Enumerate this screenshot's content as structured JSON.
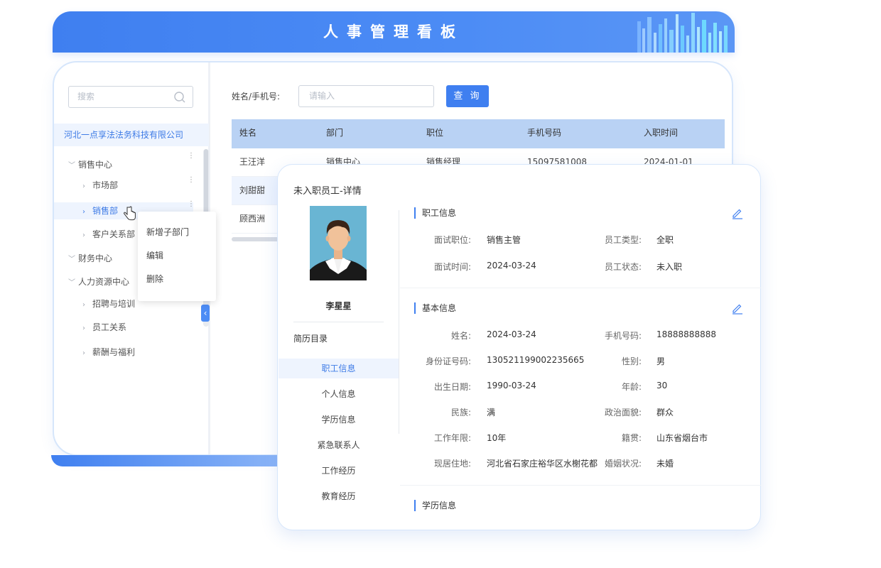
{
  "header": {
    "title": "人事管理看板"
  },
  "sidebar": {
    "search_placeholder": "搜索",
    "company": "河北一点享法法务科技有限公司",
    "tree": {
      "sales_center": "销售中心",
      "market": "市场部",
      "sales": "销售部",
      "customer": "客户关系部",
      "finance": "财务中心",
      "hr_center": "人力资源中心",
      "recruit": "招聘与培训",
      "relations": "员工关系",
      "salary": "薪酬与福利"
    },
    "context_menu": {
      "add_sub": "新增子部门",
      "edit": "编辑",
      "delete": "删除"
    }
  },
  "query": {
    "label": "姓名/手机号:",
    "placeholder": "请输入",
    "button": "查 询"
  },
  "table": {
    "columns": [
      "姓名",
      "部门",
      "职位",
      "手机号码",
      "入职时间"
    ],
    "rows": [
      [
        "王汪洋",
        "销售中心",
        "销售经理",
        "15097581008",
        "2024-01-01"
      ],
      [
        "刘甜甜",
        "",
        "",
        "",
        ""
      ],
      [
        "顾西洲",
        "",
        "",
        "",
        ""
      ]
    ]
  },
  "detail": {
    "title": "未入职员工-详情",
    "name": "李星星",
    "resume_title": "简历目录",
    "nav": [
      "职工信息",
      "个人信息",
      "学历信息",
      "紧急联系人",
      "工作经历",
      "教育经历"
    ],
    "job_section": {
      "title": "职工信息",
      "fields": {
        "position_label": "面试职位:",
        "position": "销售主管",
        "type_label": "员工类型:",
        "type": "全职",
        "time_label": "面试时间:",
        "time": "2024-03-24",
        "status_label": "员工状态:",
        "status": "未入职"
      }
    },
    "basic_section": {
      "title": "基本信息",
      "fields": {
        "name_label": "姓名:",
        "name": "2024-03-24",
        "phone_label": "手机号码:",
        "phone": "18888888888",
        "id_label": "身份证号码:",
        "id": "130521199002235665",
        "gender_label": "性别:",
        "gender": "男",
        "birth_label": "出生日期:",
        "birth": "1990-03-24",
        "age_label": "年龄:",
        "age": "30",
        "ethnic_label": "民族:",
        "ethnic": "满",
        "political_label": "政治面貌:",
        "political": "群众",
        "years_label": "工作年限:",
        "years": "10年",
        "native_label": "籍贯:",
        "native": "山东省烟台市",
        "address_label": "现居住地:",
        "address": "河北省石家庄裕华区水榭花都",
        "marital_label": "婚姻状况:",
        "marital": "未婚"
      }
    },
    "edu_section": {
      "title": "学历信息"
    }
  },
  "colors": {
    "primary": "#3f7ff0",
    "header_row": "#b9d2f4",
    "active_bg": "#eef4fe"
  }
}
